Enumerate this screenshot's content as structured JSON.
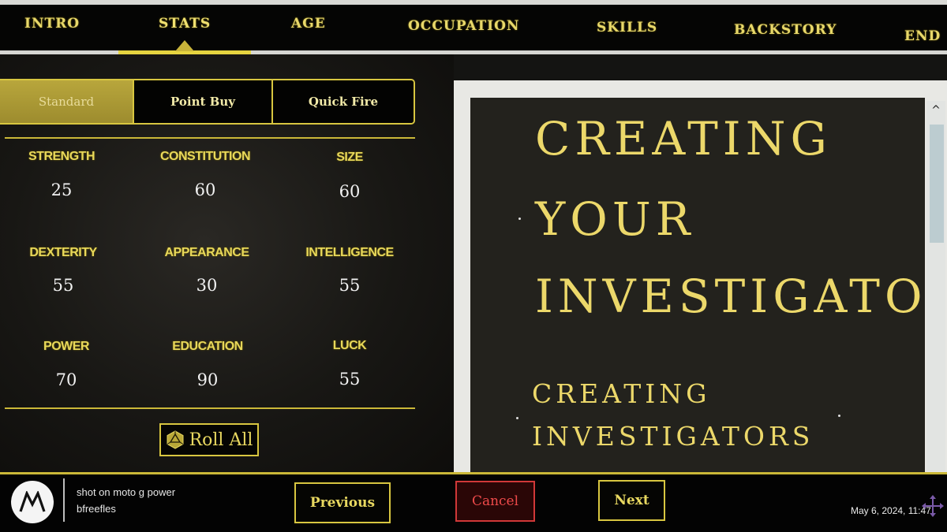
{
  "nav": {
    "tabs": [
      {
        "label": "INTRO",
        "active": false
      },
      {
        "label": "STATS",
        "active": true
      },
      {
        "label": "AGE",
        "active": false
      },
      {
        "label": "OCCUPATION",
        "active": false
      },
      {
        "label": "SKILLS",
        "active": false
      },
      {
        "label": "BACKSTORY",
        "active": false
      },
      {
        "label": "END",
        "active": false
      }
    ]
  },
  "modes": {
    "selected": "Standard",
    "options": [
      "Standard",
      "Point Buy",
      "Quick Fire"
    ]
  },
  "stats": [
    {
      "label": "STRENGTH",
      "value": "25"
    },
    {
      "label": "CONSTITUTION",
      "value": "60"
    },
    {
      "label": "SIZE",
      "value": "60"
    },
    {
      "label": "DEXTERITY",
      "value": "55"
    },
    {
      "label": "APPEARANCE",
      "value": "30"
    },
    {
      "label": "INTELLIGENCE",
      "value": "55"
    },
    {
      "label": "POWER",
      "value": "70"
    },
    {
      "label": "EDUCATION",
      "value": "90"
    },
    {
      "label": "LUCK",
      "value": "55"
    }
  ],
  "roll_all": {
    "label": "Roll All",
    "icon": "d20-dice-icon"
  },
  "document": {
    "heading_lines": [
      "CREATING",
      "YOUR",
      "INVESTIGATO"
    ],
    "subheading_lines": [
      "CREATING",
      "INVESTIGATORS"
    ],
    "scroll_up_glyph": "^"
  },
  "footer": {
    "previous_label": "Previous",
    "cancel_label": "Cancel",
    "next_label": "Next"
  },
  "watermark": {
    "line1": "shot on moto g power",
    "line2": "bfreefles",
    "timestamp": "May 6, 2024, 11:47"
  },
  "colors": {
    "accent_gold": "#e8d860",
    "cancel_red": "#ee4a4a",
    "panel_dark": "#23221d"
  }
}
